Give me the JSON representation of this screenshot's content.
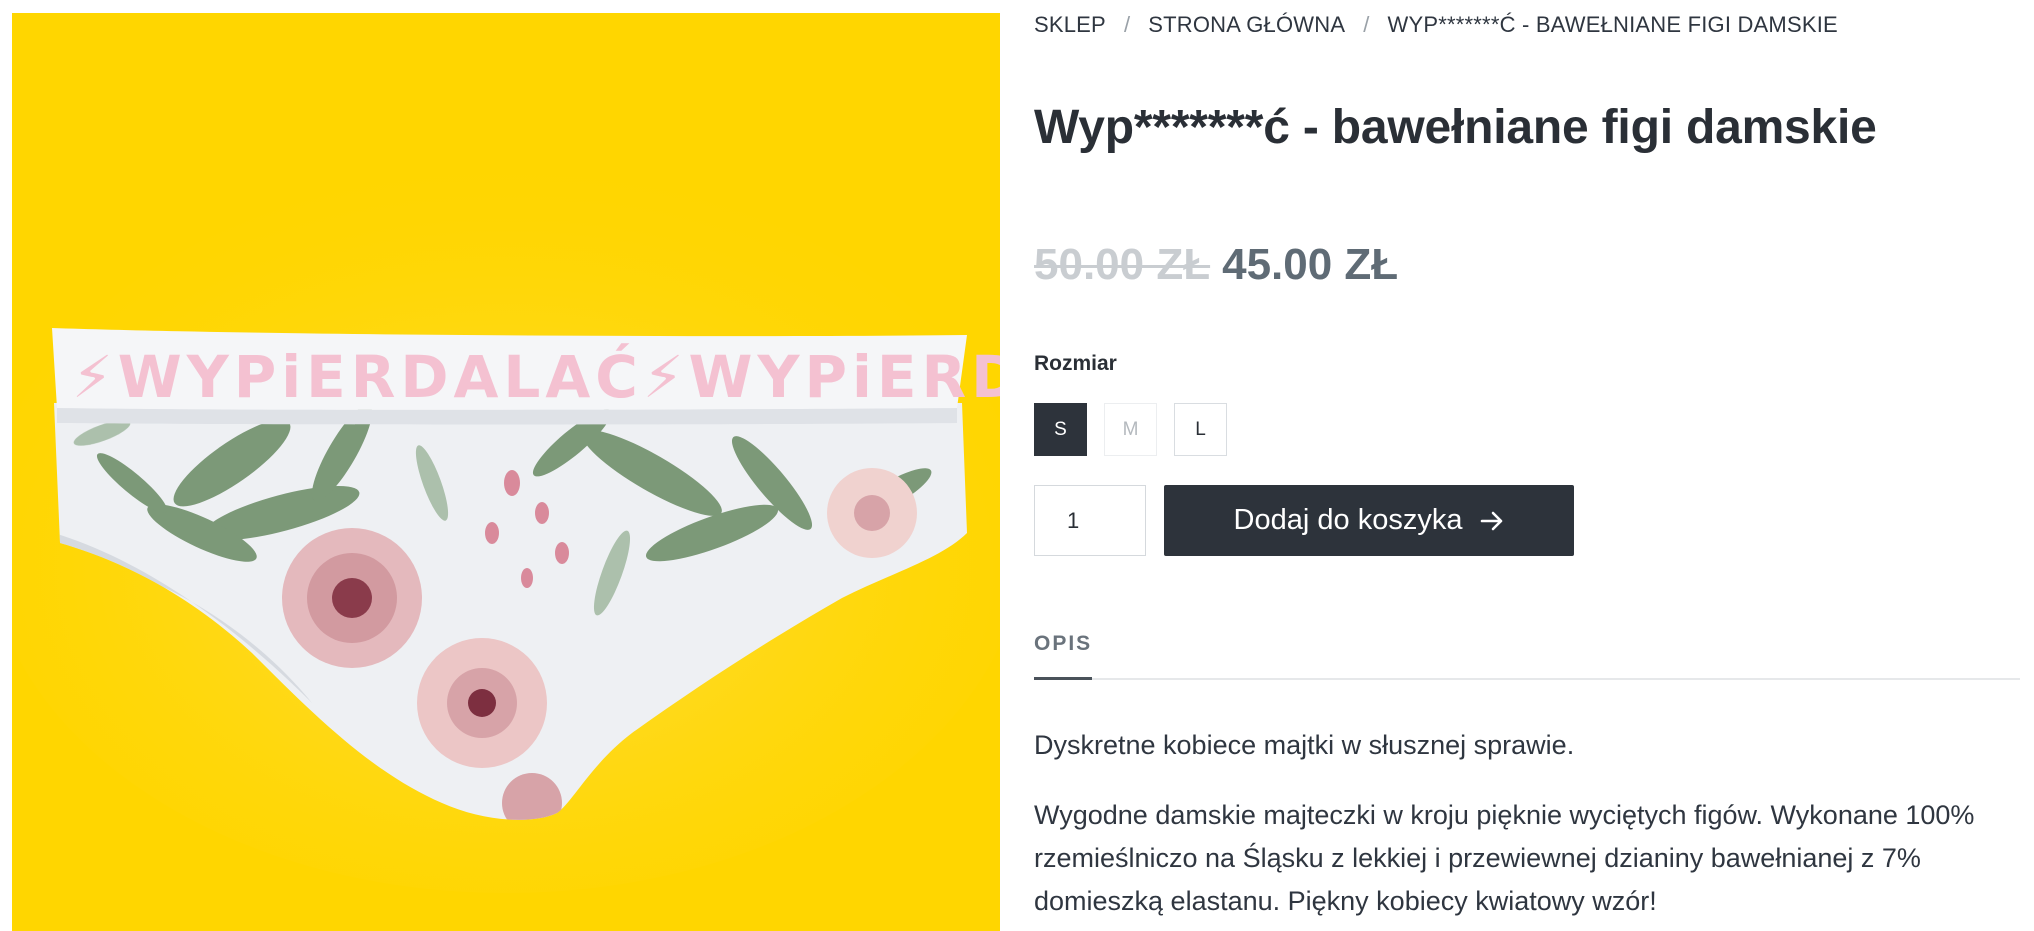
{
  "breadcrumb": {
    "items": [
      "SKLEP",
      "STRONA GŁÓWNA",
      "WYP*******Ć - BAWEŁNIANE FIGI DAMSKIE"
    ],
    "separator": "/"
  },
  "product": {
    "title": "Wyp*******ć - bawełniane figi damskie",
    "image_alt": "Bawełniane figi damskie w kwiaty z gumką WYPiERDALAĆ",
    "waistband_text": "WYPiERDALAĆ",
    "price_old": "50.00 ZŁ",
    "price_new": "45.00 ZŁ"
  },
  "size": {
    "label": "Rozmiar",
    "options": [
      {
        "label": "S",
        "state": "selected"
      },
      {
        "label": "M",
        "state": "disabled"
      },
      {
        "label": "L",
        "state": "available"
      }
    ]
  },
  "cart": {
    "quantity": "1",
    "add_label": "Dodaj do koszyka"
  },
  "tabs": {
    "active": "OPIS"
  },
  "description": {
    "p1": "Dyskretne kobiece majtki w słusznej sprawie.",
    "p2": "Wygodne damskie majteczki w kroju pięknie wyciętych figów. Wykonane 100% rzemieślniczo na Śląsku z lekkiej i przewiewnej dzianiny bawełnianej z 7% domieszką elastanu. Piękny kobiecy kwiatowy wzór!"
  },
  "colors": {
    "image_background": "#ffd600",
    "dark_button": "#2d333b",
    "price_new": "#5f6b75",
    "price_old": "#c9cdd1",
    "waistband_text": "#f4c1d1"
  },
  "icons": {
    "add_to_cart": "arrow-right-icon"
  }
}
